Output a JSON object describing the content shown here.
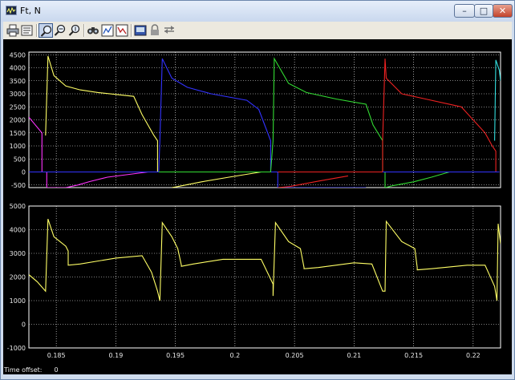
{
  "window": {
    "title": "Ft, N",
    "min_symbol": "–",
    "max_symbol": "□",
    "close_symbol": "✕"
  },
  "toolbar": {
    "buttons": [
      {
        "name": "print-icon"
      },
      {
        "name": "parameters-icon"
      },
      {
        "name": "zoom-icon",
        "pressed": true
      },
      {
        "name": "zoom-x-icon"
      },
      {
        "name": "zoom-y-icon"
      },
      {
        "name": "autoscale-icon"
      },
      {
        "name": "save-axes-icon"
      },
      {
        "name": "restore-axes-icon"
      },
      {
        "name": "floating-scope-icon"
      },
      {
        "name": "lock-icon"
      },
      {
        "name": "signal-selection-icon"
      }
    ]
  },
  "colors": {
    "background": "#000000",
    "axes": "#ffffff",
    "grid": "#ffffff",
    "text": "#e8e8e8",
    "series": [
      "#ffff66",
      "#ff33ff",
      "#3333ff",
      "#33dd33",
      "#ee2222",
      "#33dddd"
    ]
  },
  "status": {
    "time_offset_label": "Time offset:",
    "time_offset_value": "0"
  },
  "chart_data": [
    {
      "type": "line",
      "title": "",
      "grid": true,
      "xlim": [
        0.1827,
        0.2223
      ],
      "ylim": [
        -600,
        4600
      ],
      "yticks": [
        "-500",
        "0",
        "500",
        "1000",
        "1500",
        "2000",
        "2500",
        "3000",
        "3500",
        "4000",
        "4500"
      ],
      "xticks": [
        "0.185",
        "0.19",
        "0.195",
        "0.2",
        "0.205",
        "0.21",
        "0.215",
        "0.22"
      ],
      "xtick_labels_shown": false,
      "series": [
        {
          "color": "#ff33ff",
          "x": [
            0.1827,
            0.1838,
            0.1838,
            0.1842,
            0.1842,
            0.1858,
            0.1868,
            0.1878,
            0.1893,
            0.1927
          ],
          "y": [
            2100,
            1500,
            0,
            0,
            -600,
            -600,
            -500,
            -370,
            -200,
            0
          ]
        },
        {
          "color": "#ffff66",
          "x": [
            0.1841,
            0.1843,
            0.1848,
            0.1858,
            0.187,
            0.1885,
            0.1915,
            0.1922,
            0.1932,
            0.1935,
            0.1935
          ],
          "y": [
            1400,
            4450,
            3700,
            3300,
            3150,
            3050,
            2900,
            2200,
            1400,
            1200,
            0
          ]
        },
        {
          "color": "#ffff66",
          "x": [
            0.1947,
            0.1952,
            0.1972,
            0.1995,
            0.2022,
            0.2022
          ],
          "y": [
            -600,
            -560,
            -380,
            -200,
            0,
            0
          ]
        },
        {
          "color": "#3333ff",
          "x": [
            0.1827,
            0.1936,
            0.1937,
            0.1939,
            0.1947,
            0.196,
            0.198,
            0.201,
            0.202,
            0.203,
            0.203,
            0.2036,
            0.2036,
            0.211
          ],
          "y": [
            0,
            0,
            1200,
            4350,
            3600,
            3250,
            3000,
            2750,
            2400,
            1200,
            0,
            0,
            -600,
            -600
          ]
        },
        {
          "color": "#33dd33",
          "x": [
            0.1936,
            0.203,
            0.2032,
            0.2033,
            0.2045,
            0.206,
            0.2085,
            0.211,
            0.2116,
            0.2124,
            0.2124
          ],
          "y": [
            0,
            0,
            1200,
            4350,
            3400,
            3050,
            2800,
            2600,
            1800,
            1200,
            0
          ]
        },
        {
          "color": "#33dd33",
          "x": [
            0.2124,
            0.2126,
            0.2126,
            0.2133,
            0.215,
            0.2165,
            0.218
          ],
          "y": [
            0,
            0,
            -600,
            -520,
            -380,
            -200,
            0
          ]
        },
        {
          "color": "#ee2222",
          "x": [
            0.2036,
            0.2124,
            0.2124,
            0.2126,
            0.2127,
            0.214,
            0.216,
            0.219,
            0.221,
            0.2216,
            0.2219,
            0.2219
          ],
          "y": [
            0,
            0,
            1200,
            4350,
            3600,
            3000,
            2800,
            2500,
            1500,
            1000,
            800,
            0
          ]
        },
        {
          "color": "#ee2222",
          "x": [
            0.2036,
            0.2046,
            0.207,
            0.2095
          ],
          "y": [
            -600,
            -560,
            -350,
            -150
          ]
        },
        {
          "color": "#3333ff",
          "x": [
            0.2124,
            0.2222
          ],
          "y": [
            0,
            0
          ]
        },
        {
          "color": "#33dddd",
          "x": [
            0.2218,
            0.2219,
            0.2222,
            0.2223
          ],
          "y": [
            1200,
            4300,
            3900,
            3500
          ]
        }
      ]
    },
    {
      "type": "line",
      "title": "",
      "grid": true,
      "xlim": [
        0.1827,
        0.2223
      ],
      "ylim": [
        -1000,
        5000
      ],
      "yticks": [
        "-1000",
        "0",
        "1000",
        "2000",
        "3000",
        "4000",
        "5000"
      ],
      "xticks": [
        "0.185",
        "0.19",
        "0.195",
        "0.2",
        "0.205",
        "0.21",
        "0.215",
        "0.22"
      ],
      "xtick_labels_shown": true,
      "series": [
        {
          "color": "#ffff66",
          "x": [
            0.1827,
            0.1834,
            0.1841,
            0.1843,
            0.1848,
            0.1858,
            0.186,
            0.186,
            0.187,
            0.19,
            0.1922,
            0.193,
            0.1935,
            0.1937,
            0.1939,
            0.1947,
            0.1952,
            0.1955,
            0.1955,
            0.1965,
            0.199,
            0.2022,
            0.2032,
            0.2032,
            0.2034,
            0.2045,
            0.2055,
            0.2058,
            0.2058,
            0.207,
            0.21,
            0.2115,
            0.2124,
            0.2126,
            0.2127,
            0.214,
            0.2151,
            0.2153,
            0.2153,
            0.2165,
            0.2195,
            0.221,
            0.2218,
            0.222,
            0.2221,
            0.2223
          ],
          "y": [
            2100,
            1800,
            1400,
            4450,
            3700,
            3300,
            3100,
            2500,
            2550,
            2800,
            2900,
            2200,
            1400,
            1000,
            4300,
            3700,
            3200,
            2500,
            2450,
            2550,
            2750,
            2750,
            1700,
            1200,
            4300,
            3500,
            3200,
            2400,
            2350,
            2400,
            2600,
            2550,
            1400,
            1400,
            4350,
            3500,
            3200,
            2400,
            2300,
            2350,
            2500,
            2500,
            1600,
            1000,
            4250,
            3400
          ]
        }
      ]
    }
  ]
}
